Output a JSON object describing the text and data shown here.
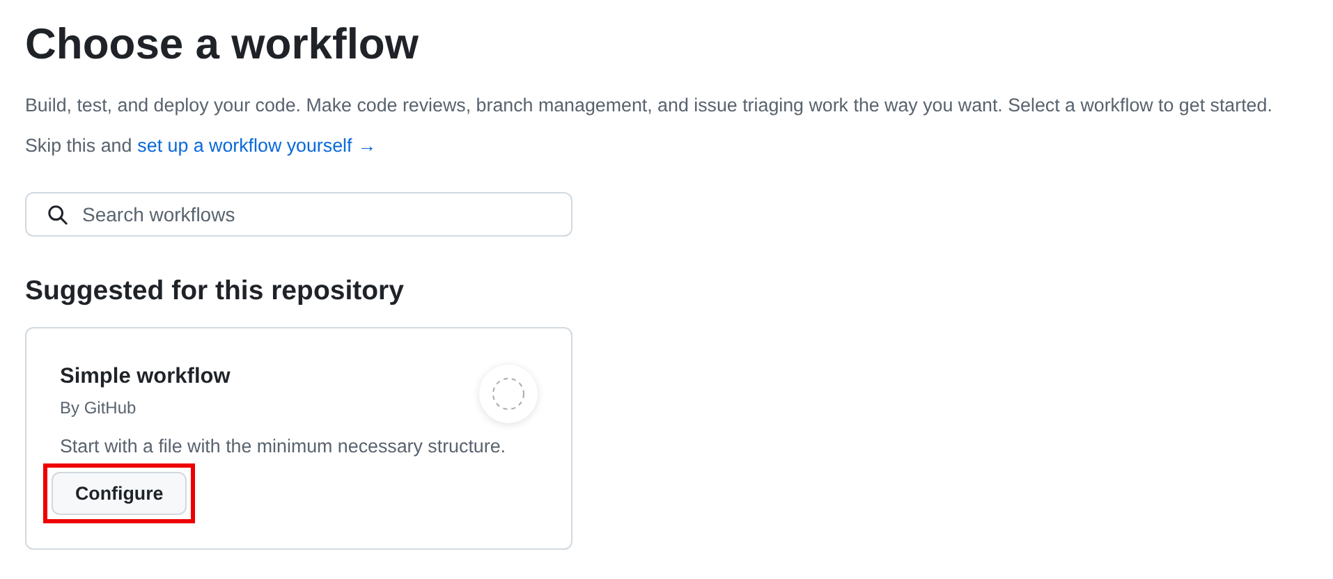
{
  "title": "Choose a workflow",
  "description": "Build, test, and deploy your code. Make code reviews, branch management, and issue triaging work the way you want. Select a workflow to get started.",
  "skip": {
    "text": "Skip this and",
    "link": "set up a workflow yourself",
    "arrow": "→"
  },
  "search": {
    "placeholder": "Search workflows"
  },
  "section_title": "Suggested for this repository",
  "workflows": [
    {
      "name": "Simple workflow",
      "author": "By GitHub",
      "description": "Start with a file with the minimum necessary structure.",
      "button": "Configure",
      "highlighted": true
    }
  ]
}
